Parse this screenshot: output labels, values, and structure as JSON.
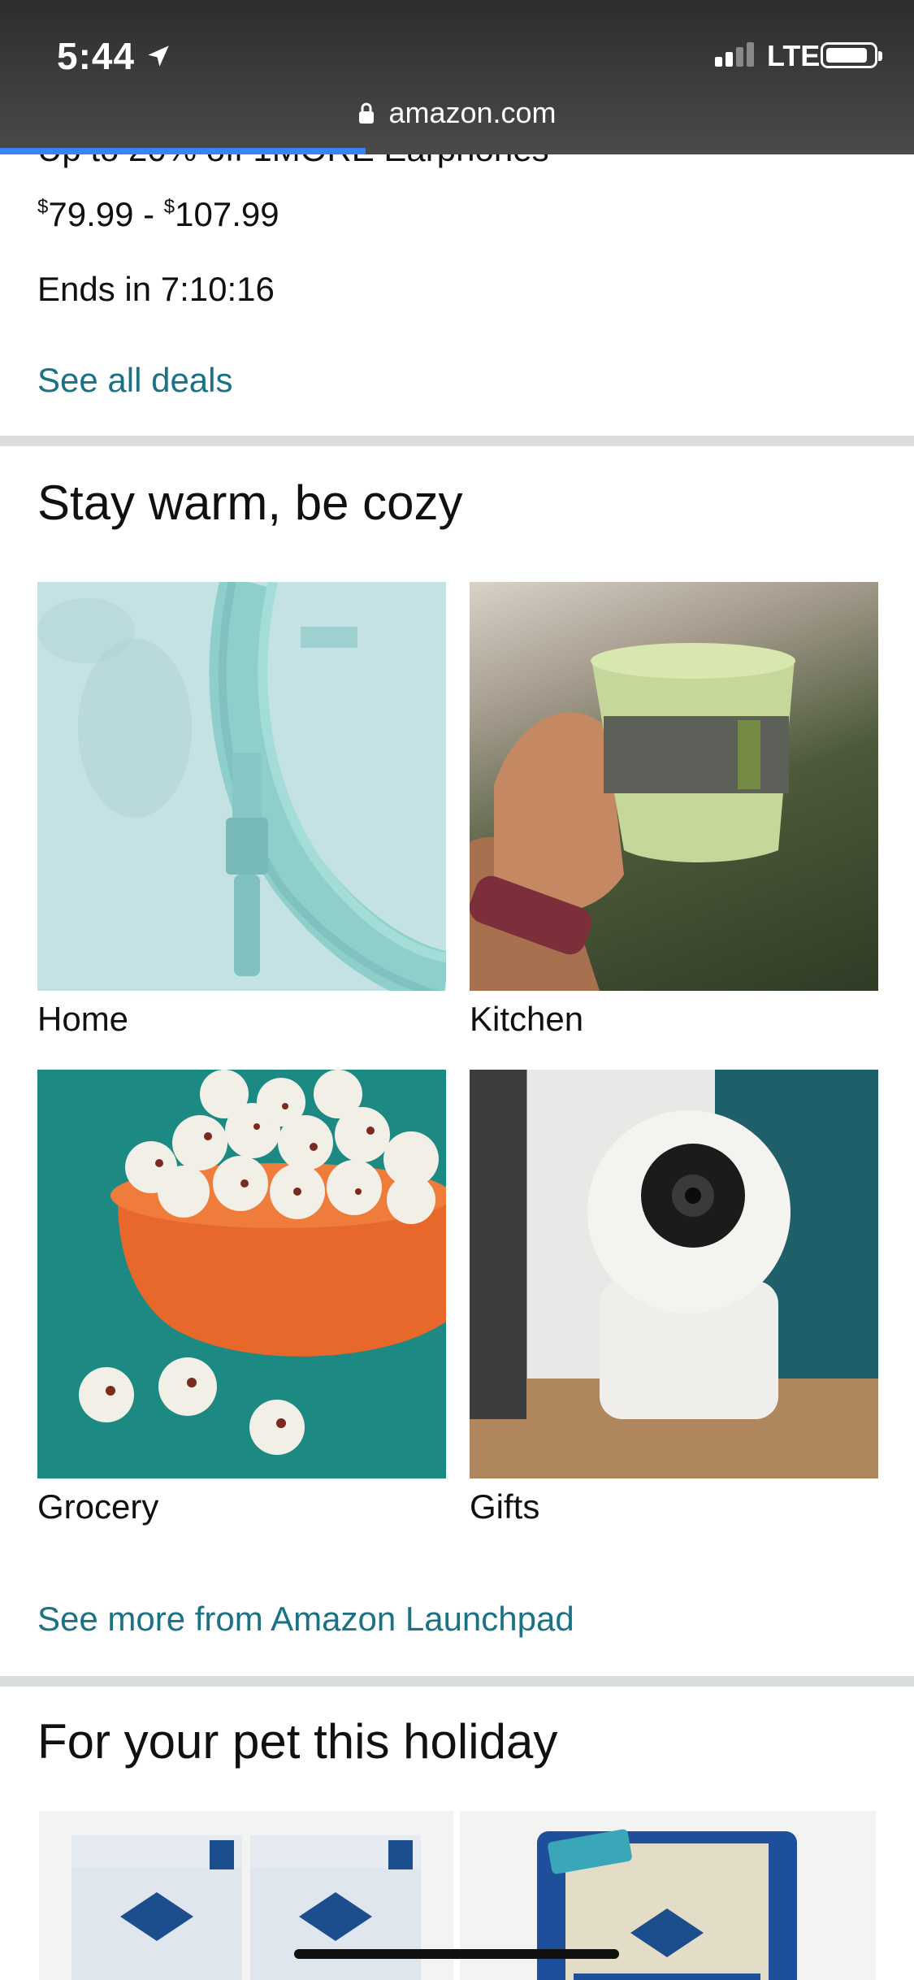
{
  "status_bar": {
    "time": "5:44",
    "network": "LTE",
    "url": "amazon.com",
    "load_progress_pct": 40
  },
  "deal": {
    "title_partial": "Up to 20% off 1MORE Earphones",
    "price_currency": "$",
    "price_low": "79.99",
    "price_high": "107.99",
    "price_separator": " - ",
    "ends": "Ends in 7:10:16",
    "see_all": "See all deals"
  },
  "cozy": {
    "title": "Stay warm, be cozy",
    "tiles": [
      {
        "label": "Home"
      },
      {
        "label": "Kitchen"
      },
      {
        "label": "Grocery"
      },
      {
        "label": "Gifts"
      }
    ],
    "see_more": "See more from Amazon Launchpad"
  },
  "pet": {
    "title": "For your pet this holiday"
  },
  "colors": {
    "link": "#1b7284",
    "divider": "#dadddd",
    "progress": "#3b82f6"
  }
}
